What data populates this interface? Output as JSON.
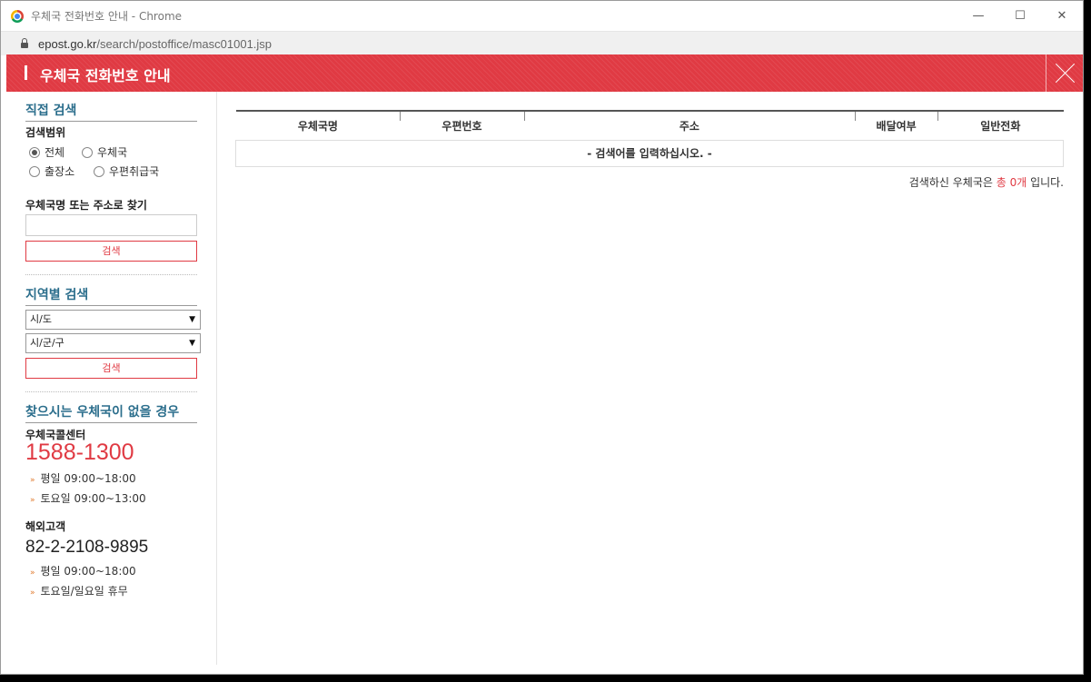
{
  "window": {
    "title": "우체국 전화번호 안내 - Chrome",
    "controls": [
      "—",
      "☐",
      "✕"
    ]
  },
  "address": {
    "host": "epost.go.kr",
    "path": "/search/postoffice/masc01001.jsp"
  },
  "header": {
    "title": "우체국 전화번호 안내"
  },
  "direct_search": {
    "title": "직접 검색",
    "scope_label": "검색범위",
    "scope_options": [
      "전체",
      "우체국",
      "출장소",
      "우편취급국"
    ],
    "scope_selected": "전체",
    "name_label": "우체국명 또는 주소로 찾기",
    "button": "검색"
  },
  "region_search": {
    "title": "지역별 검색",
    "sido": "시/도",
    "sigungu": "시/군/구",
    "button": "검색"
  },
  "help": {
    "title": "찾으시는 우체국이 없을 경우",
    "call_center_label": "우체국콜센터",
    "call_center_number": "1588-1300",
    "call_center_hours": [
      "평일 09:00~18:00",
      "토요일 09:00~13:00"
    ],
    "overseas_label": "해외고객",
    "overseas_number": "82-2-2108-9895",
    "overseas_hours": [
      "평일 09:00~18:00",
      "토요일/일요일 휴무"
    ]
  },
  "table": {
    "columns": [
      "우체국명",
      "우편번호",
      "주소",
      "배달여부",
      "일반전화"
    ],
    "empty_message": "- 검색어를 입력하십시오. -"
  },
  "result": {
    "prefix": "검색하신 우체국은 ",
    "count": "총 0개",
    "suffix": " 입니다."
  }
}
